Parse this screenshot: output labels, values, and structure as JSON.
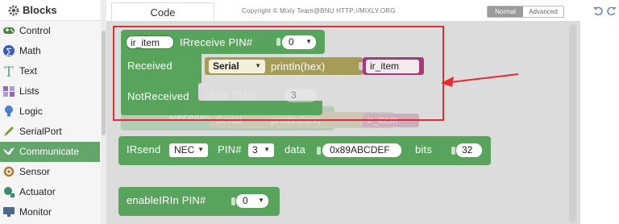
{
  "sidebar": {
    "title": "Blocks",
    "items": [
      {
        "label": "Control",
        "icon": "gamepad-icon",
        "color": "#47863d"
      },
      {
        "label": "Math",
        "icon": "math-icon",
        "color": "#3a5bbd"
      },
      {
        "label": "Text",
        "icon": "text-t-icon",
        "color": "#5aa38f"
      },
      {
        "label": "Lists",
        "icon": "list-icon",
        "color": "#8e6bb7"
      },
      {
        "label": "Logic",
        "icon": "bulb-icon",
        "color": "#4b7fcf"
      },
      {
        "label": "SerialPort",
        "icon": "pen-icon",
        "color": "#7d9a2e"
      },
      {
        "label": "Communicate",
        "icon": "dove-icon",
        "color": "#ffffff",
        "active": true
      },
      {
        "label": "Sensor",
        "icon": "sensor-icon",
        "color": "#b07b2f"
      },
      {
        "label": "Actuator",
        "icon": "actuator-icon",
        "color": "#3d8a6a"
      },
      {
        "label": "Monitor",
        "icon": "monitor-icon",
        "color": "#4c6b8a"
      }
    ]
  },
  "topbar": {
    "tab": "Code",
    "copyright": "Copyright © Mixly Team@BNU HTTP://MIXLY.ORG",
    "mode_normal": "Normal",
    "mode_advanced": "Advanced"
  },
  "blocks": {
    "irreceive": {
      "var": "ir_item",
      "label": "IRreceive PIN#",
      "pin": "0",
      "received": "Received",
      "notreceived": "NotReceived",
      "serial": "Serial",
      "println": "println(hex)",
      "println_arg": "ir_item",
      "ghost_label": "ceive PIN#",
      "ghost_pin": "3",
      "ghost_received": "Received",
      "ghost_serial": "Serial",
      "ghost_println": "println(hex)",
      "ghost_item": "ir_item"
    },
    "irsend": {
      "label": "IRsend",
      "protocol": "NEC",
      "pin_label": "PIN#",
      "pin": "3",
      "data_label": "data",
      "data": "0x89ABCDEF",
      "bits_label": "bits",
      "bits": "32"
    },
    "enableirin": {
      "label": "enableIRIn PIN#",
      "pin": "0"
    }
  },
  "colors": {
    "block_green": "#58a45c",
    "serial_olive": "#a59c56",
    "var_purple": "#a53b78",
    "highlight": "#e52a32"
  }
}
